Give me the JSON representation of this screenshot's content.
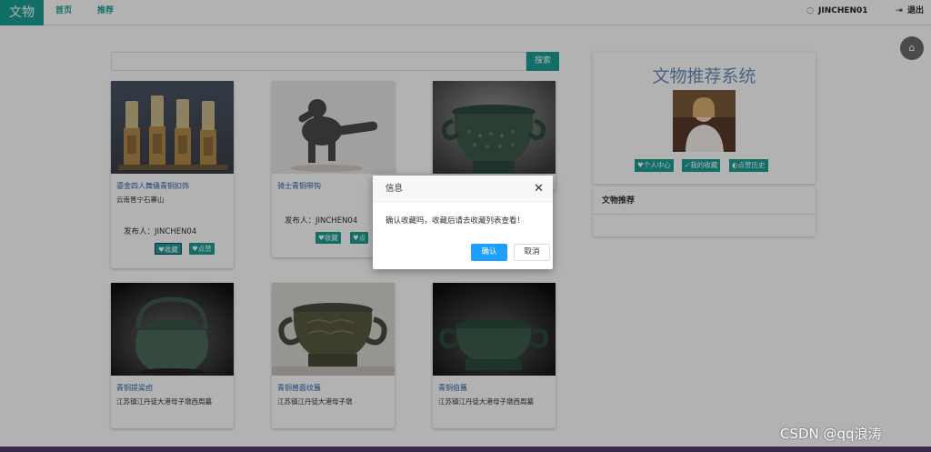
{
  "nav": {
    "brand": "文物",
    "home": "首页",
    "recommend": "推荐",
    "user": "JINCHEN01",
    "logout": "退出"
  },
  "search": {
    "button": "搜索",
    "placeholder": ""
  },
  "cards": [
    {
      "title": "鎏金四人舞俑青铜扣饰",
      "location": "云南晋宁石寨山",
      "publisher": "发布人：JINCHEN04",
      "collect": "收藏",
      "like": "点赞"
    },
    {
      "title": "骑士青铜带钩",
      "location": "",
      "publisher": "发布人：JINCHEN04",
      "collect": "收藏",
      "like": "点"
    },
    {
      "title": "",
      "location": ""
    },
    {
      "title": "青铜提梁卣",
      "location": "江苏镇江丹徒大港母子墩西周墓"
    },
    {
      "title": "青铜兽面纹簋",
      "location": "江苏镇江丹徒大港母子墩"
    },
    {
      "title": "青铜伯簋",
      "location": "江苏镇江丹徒大港母子墩西周墓"
    }
  ],
  "sidebar": {
    "title": "文物推荐系统",
    "buttons": [
      "个人中心",
      "我的收藏",
      "点赞历史"
    ],
    "recommend_header": "文物推荐"
  },
  "dialog": {
    "title": "信息",
    "message": "确认收藏吗，收藏后请去收藏列表查看！",
    "ok": "确认",
    "cancel": "取消"
  },
  "watermark": "CSDN @qq浪涛",
  "colors": {
    "accent": "#1aa094",
    "primary_button": "#1e9fff",
    "link": "#2a5ea8"
  }
}
